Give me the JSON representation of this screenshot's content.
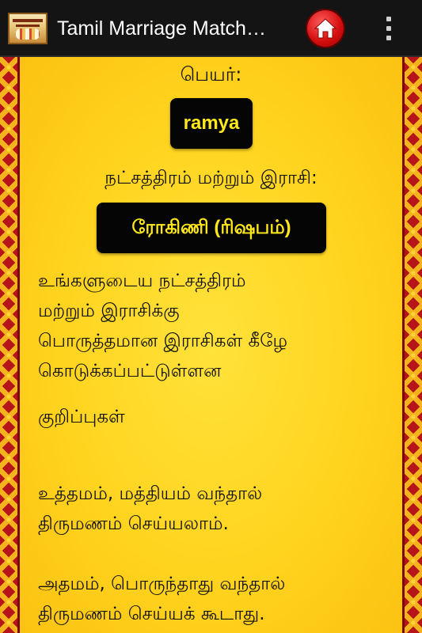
{
  "header": {
    "title": "Tamil Marriage Match…",
    "app_icon": "app-logo-icon",
    "home_icon": "home-icon",
    "overflow_icon": "overflow-menu-icon"
  },
  "main": {
    "name_label": "பெயர்:",
    "name_value": "ramya",
    "star_label": "நட்சத்திரம் மற்றும் இராசி:",
    "star_value": "ரோகிணி (ரிஷபம்)",
    "description_lines": [
      "உங்களுடைய நட்சத்திரம்",
      "மற்றும் இராசிக்கு",
      "பொருத்தமான இராசிகள் கீழே",
      "கொடுக்கப்பட்டுள்ளன"
    ],
    "notes_heading": "குறிப்புகள்",
    "note1_lines": [
      "உத்தமம், மத்தியம் வந்தால்",
      "திருமணம் செய்யலாம்."
    ],
    "note2_lines": [
      "அதமம், பொருந்தாது வந்தால்",
      "திருமணம் செய்யக் கூடாது."
    ]
  },
  "colors": {
    "background": "#ffd21f",
    "action_bar": "#141414",
    "pill_bg": "#050505",
    "pill_text": "#ffe81a",
    "border_red": "#b5141a"
  }
}
